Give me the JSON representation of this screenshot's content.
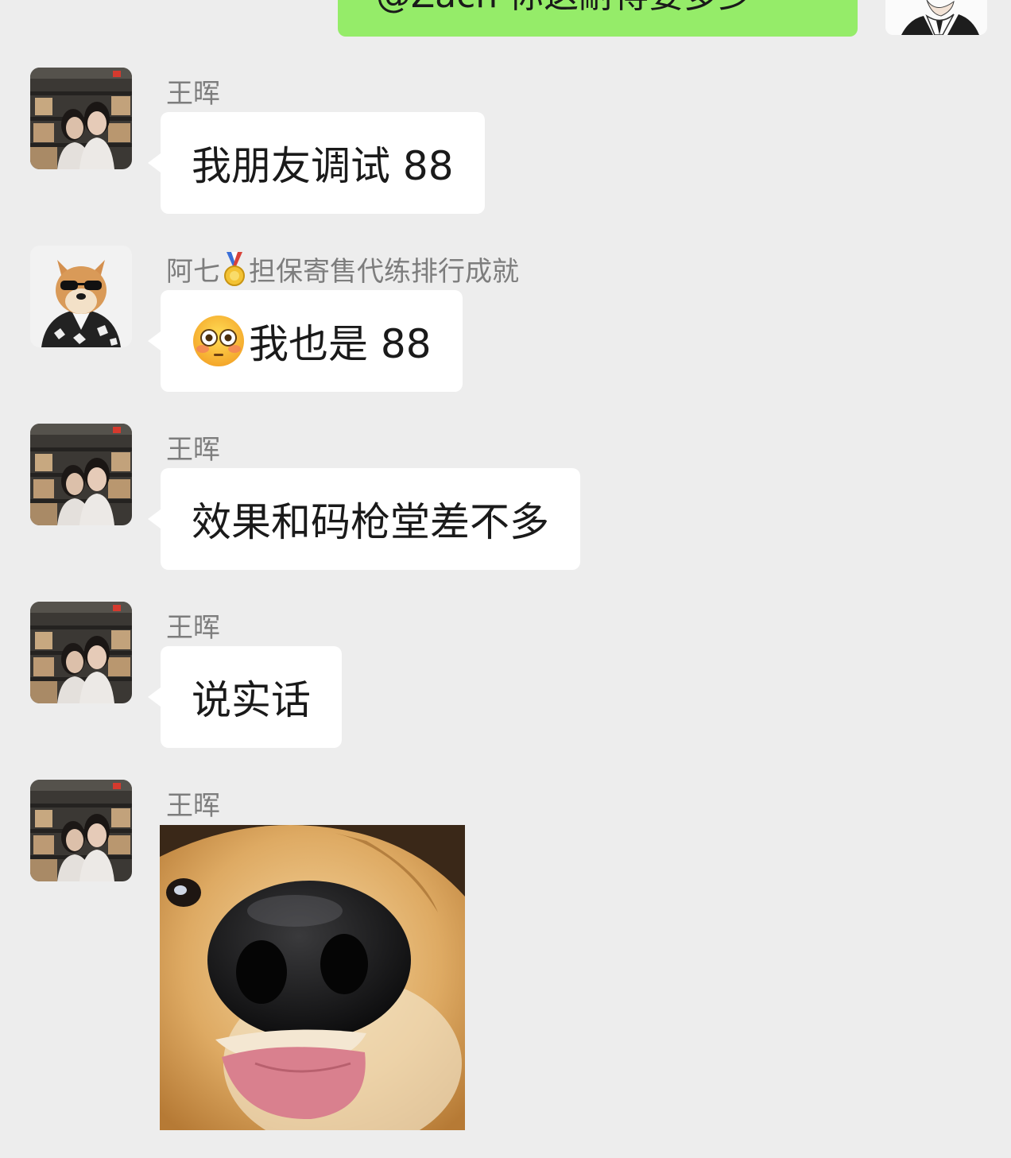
{
  "outgoing": {
    "text": "@Zach 你这耐得要多少"
  },
  "messages": [
    {
      "sender": "王晖",
      "text": "我朋友调试 88",
      "avatar": "photo-avatar"
    },
    {
      "sender": "阿七",
      "sender_suffix": "担保寄售代练排行成就",
      "badge": "medal-icon",
      "emoji": "flushed-face-emoji",
      "text": "我也是 88",
      "avatar": "shiba-sunglasses-avatar"
    },
    {
      "sender": "王晖",
      "text": "效果和码枪堂差不多",
      "avatar": "photo-avatar"
    },
    {
      "sender": "王晖",
      "text": "说实话",
      "avatar": "photo-avatar"
    },
    {
      "sender": "王晖",
      "sticker": "dog-nose-sticker",
      "avatar": "photo-avatar"
    }
  ],
  "colors": {
    "background": "#ededed",
    "incoming_bubble": "#ffffff",
    "outgoing_bubble": "#95ec69",
    "sender_name": "#7d7d7d"
  }
}
